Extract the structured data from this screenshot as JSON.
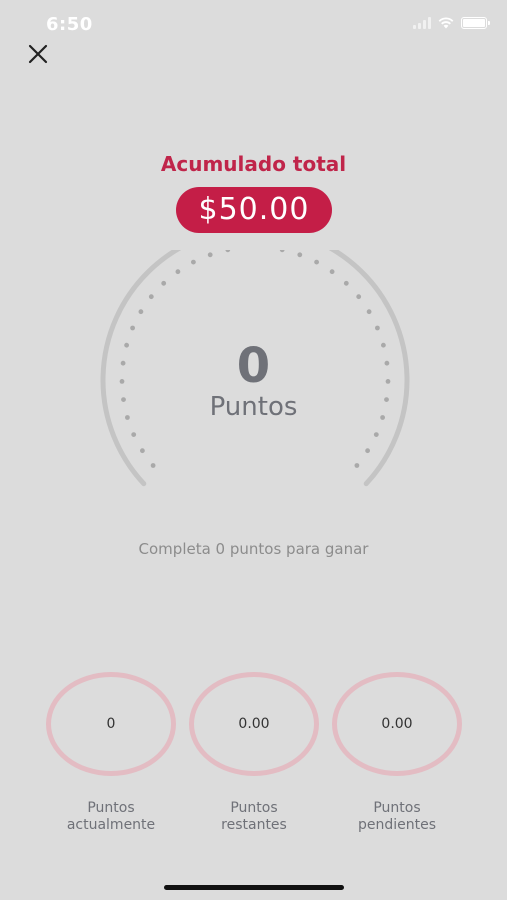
{
  "status_bar": {
    "time": "6:50"
  },
  "header": {
    "close_icon": "close-icon"
  },
  "summary": {
    "label": "Acumulado total",
    "amount": "$50.00"
  },
  "gauge": {
    "value": "0",
    "unit": "Puntos"
  },
  "hint": "Completa 0 puntos para ganar",
  "stats": [
    {
      "value": "0",
      "label_line1": "Puntos",
      "label_line2": "actualmente"
    },
    {
      "value": "0.00",
      "label_line1": "Puntos",
      "label_line2": "restantes"
    },
    {
      "value": "0.00",
      "label_line1": "Puntos",
      "label_line2": "pendientes"
    }
  ],
  "colors": {
    "accent": "#c41e47",
    "ring": "#e3bcc3",
    "background": "#dcdcdc",
    "text_gray": "#6f7178"
  }
}
